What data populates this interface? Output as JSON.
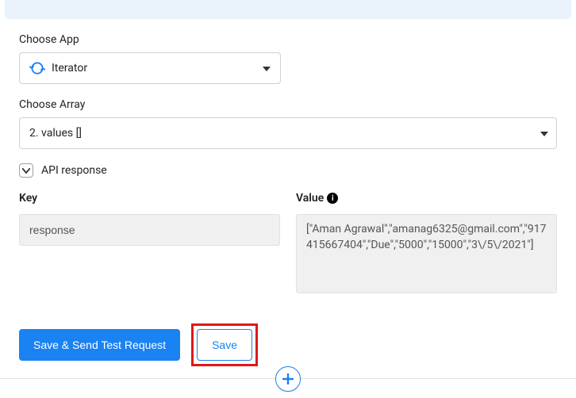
{
  "labels": {
    "choose_app": "Choose App",
    "choose_array": "Choose Array",
    "api_response": "API response",
    "key": "Key",
    "value": "Value"
  },
  "app_select": {
    "value": "Iterator"
  },
  "array_select": {
    "value": "2. values []"
  },
  "api_response_checked": true,
  "key_input": {
    "value": "response"
  },
  "value_area": {
    "value": "[\"Aman Agrawal\",\"amanag6325@gmail.com\",\"917415667404\",\"Due\",\"5000\",\"15000\",\"3\\/5\\/2021\"]"
  },
  "buttons": {
    "save_send": "Save & Send Test Request",
    "save": "Save"
  }
}
